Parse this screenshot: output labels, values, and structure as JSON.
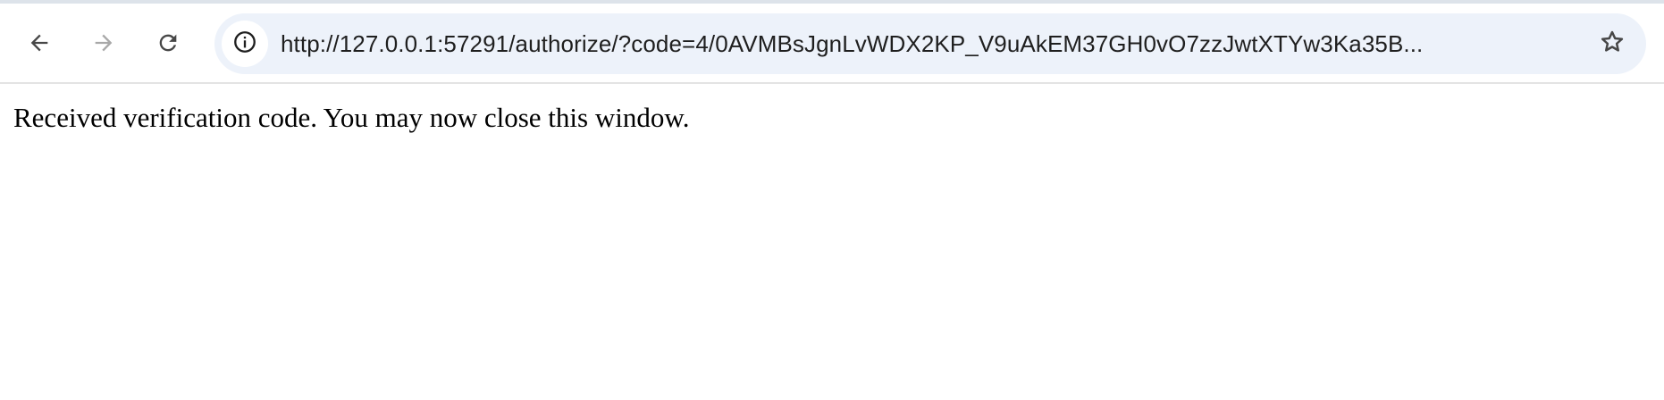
{
  "toolbar": {
    "back_icon": "arrow-left-icon",
    "forward_icon": "arrow-right-icon",
    "reload_icon": "reload-icon",
    "forward_disabled": true
  },
  "omnibox": {
    "site_info_icon": "info-icon",
    "url": "http://127.0.0.1:57291/authorize/?code=4/0AVMBsJgnLvWDX2KP_V9uAkEM37GH0vO7zzJwtXTYw3Ka35B...",
    "bookmark_icon": "star-icon"
  },
  "page": {
    "message": "Received verification code. You may now close this window."
  },
  "colors": {
    "omnibox_bg": "#edf2fa",
    "icon": "#474747",
    "icon_disabled": "#a8a8a8",
    "text": "#1f1f1f"
  }
}
